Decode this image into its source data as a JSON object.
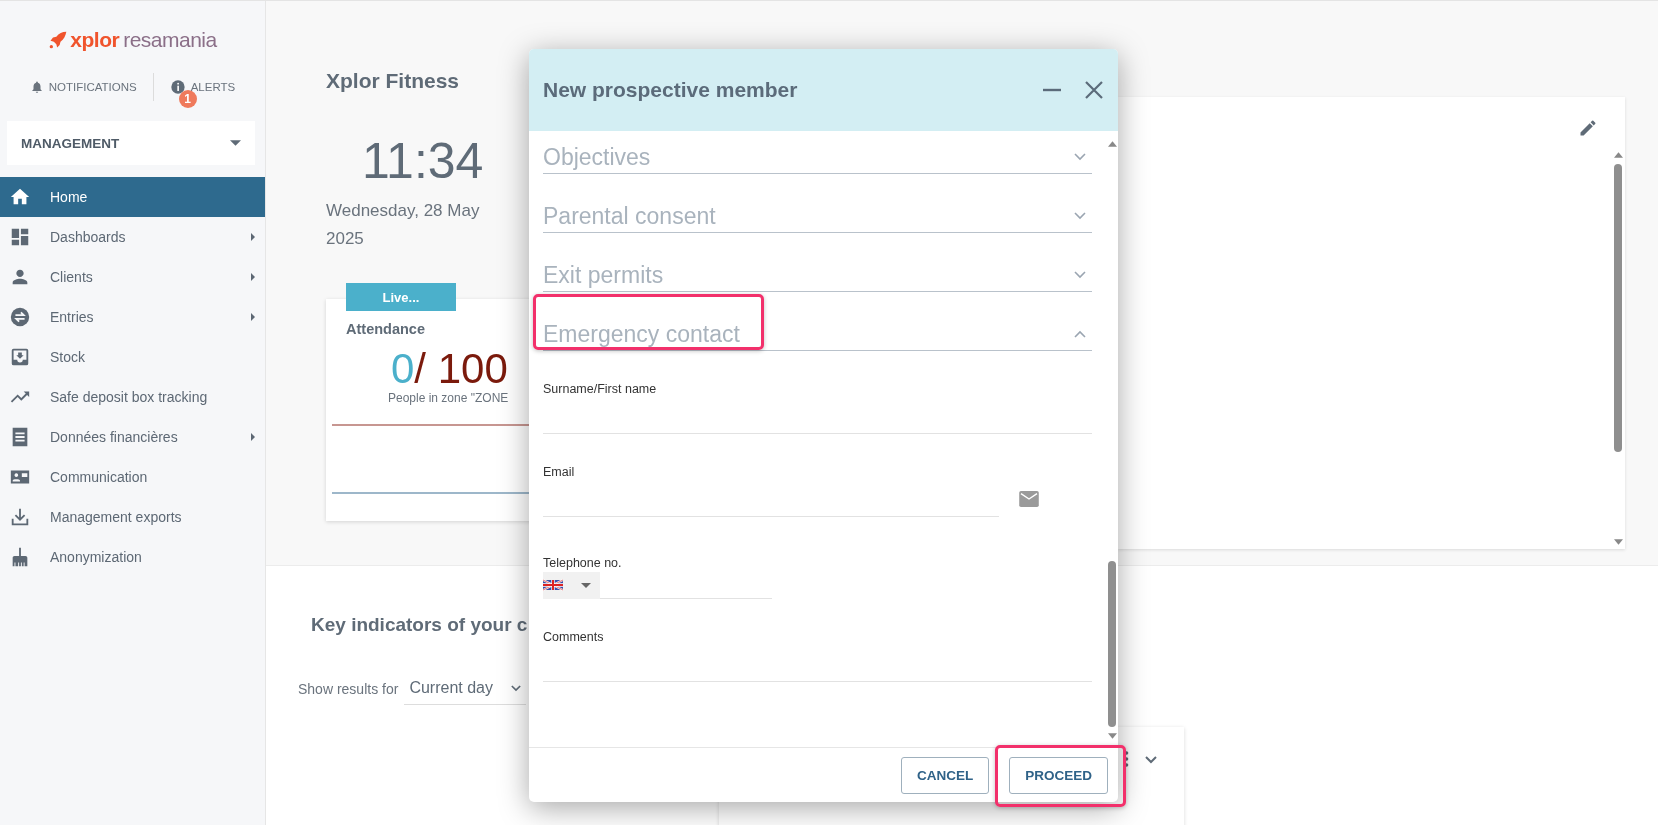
{
  "sidebar": {
    "logo": {
      "mark": "xplor",
      "name": "resamania"
    },
    "notifications": "NOTIFICATIONS",
    "alerts": {
      "label": "ALERTS",
      "badge": "1"
    },
    "context_select": "MANAGEMENT",
    "items": [
      {
        "label": "Home",
        "selected": true,
        "has_submenu": false
      },
      {
        "label": "Dashboards",
        "selected": false,
        "has_submenu": true
      },
      {
        "label": "Clients",
        "selected": false,
        "has_submenu": true
      },
      {
        "label": "Entries",
        "selected": false,
        "has_submenu": true
      },
      {
        "label": "Stock",
        "selected": false,
        "has_submenu": false
      },
      {
        "label": "Safe deposit box tracking",
        "selected": false,
        "has_submenu": false
      },
      {
        "label": "Données financières",
        "selected": false,
        "has_submenu": true
      },
      {
        "label": "Communication",
        "selected": false,
        "has_submenu": false
      },
      {
        "label": "Management exports",
        "selected": false,
        "has_submenu": false
      },
      {
        "label": "Anonymization",
        "selected": false,
        "has_submenu": false
      }
    ]
  },
  "dashboard": {
    "title": "Xplor Fitness",
    "clock": "11:34",
    "date": "Wednesday, 28 May 2025",
    "live_tag": "Live...",
    "attendance": {
      "title": "Attendance",
      "current": "0",
      "capacity": "/ 100",
      "caption": "People in zone \"ZONE"
    },
    "key_indicators_title": "Key indicators of your c",
    "filter": {
      "label": "Show results for",
      "value": "Current day"
    }
  },
  "modal": {
    "title": "New prospective member",
    "sections": [
      {
        "title": "Objectives",
        "expanded": false,
        "highlighted": false
      },
      {
        "title": "Parental consent",
        "expanded": false,
        "highlighted": false
      },
      {
        "title": "Exit permits",
        "expanded": false,
        "highlighted": false
      },
      {
        "title": "Emergency contact",
        "expanded": true,
        "highlighted": true
      }
    ],
    "fields": [
      {
        "label": "Surname/First name",
        "kind": "text"
      },
      {
        "label": "Email",
        "kind": "email"
      },
      {
        "label": "Telephone no.",
        "kind": "phone"
      },
      {
        "label": "Comments",
        "kind": "text"
      }
    ],
    "buttons": [
      {
        "label": "CANCEL",
        "highlighted": false
      },
      {
        "label": "PROCEED",
        "highlighted": true
      }
    ]
  }
}
